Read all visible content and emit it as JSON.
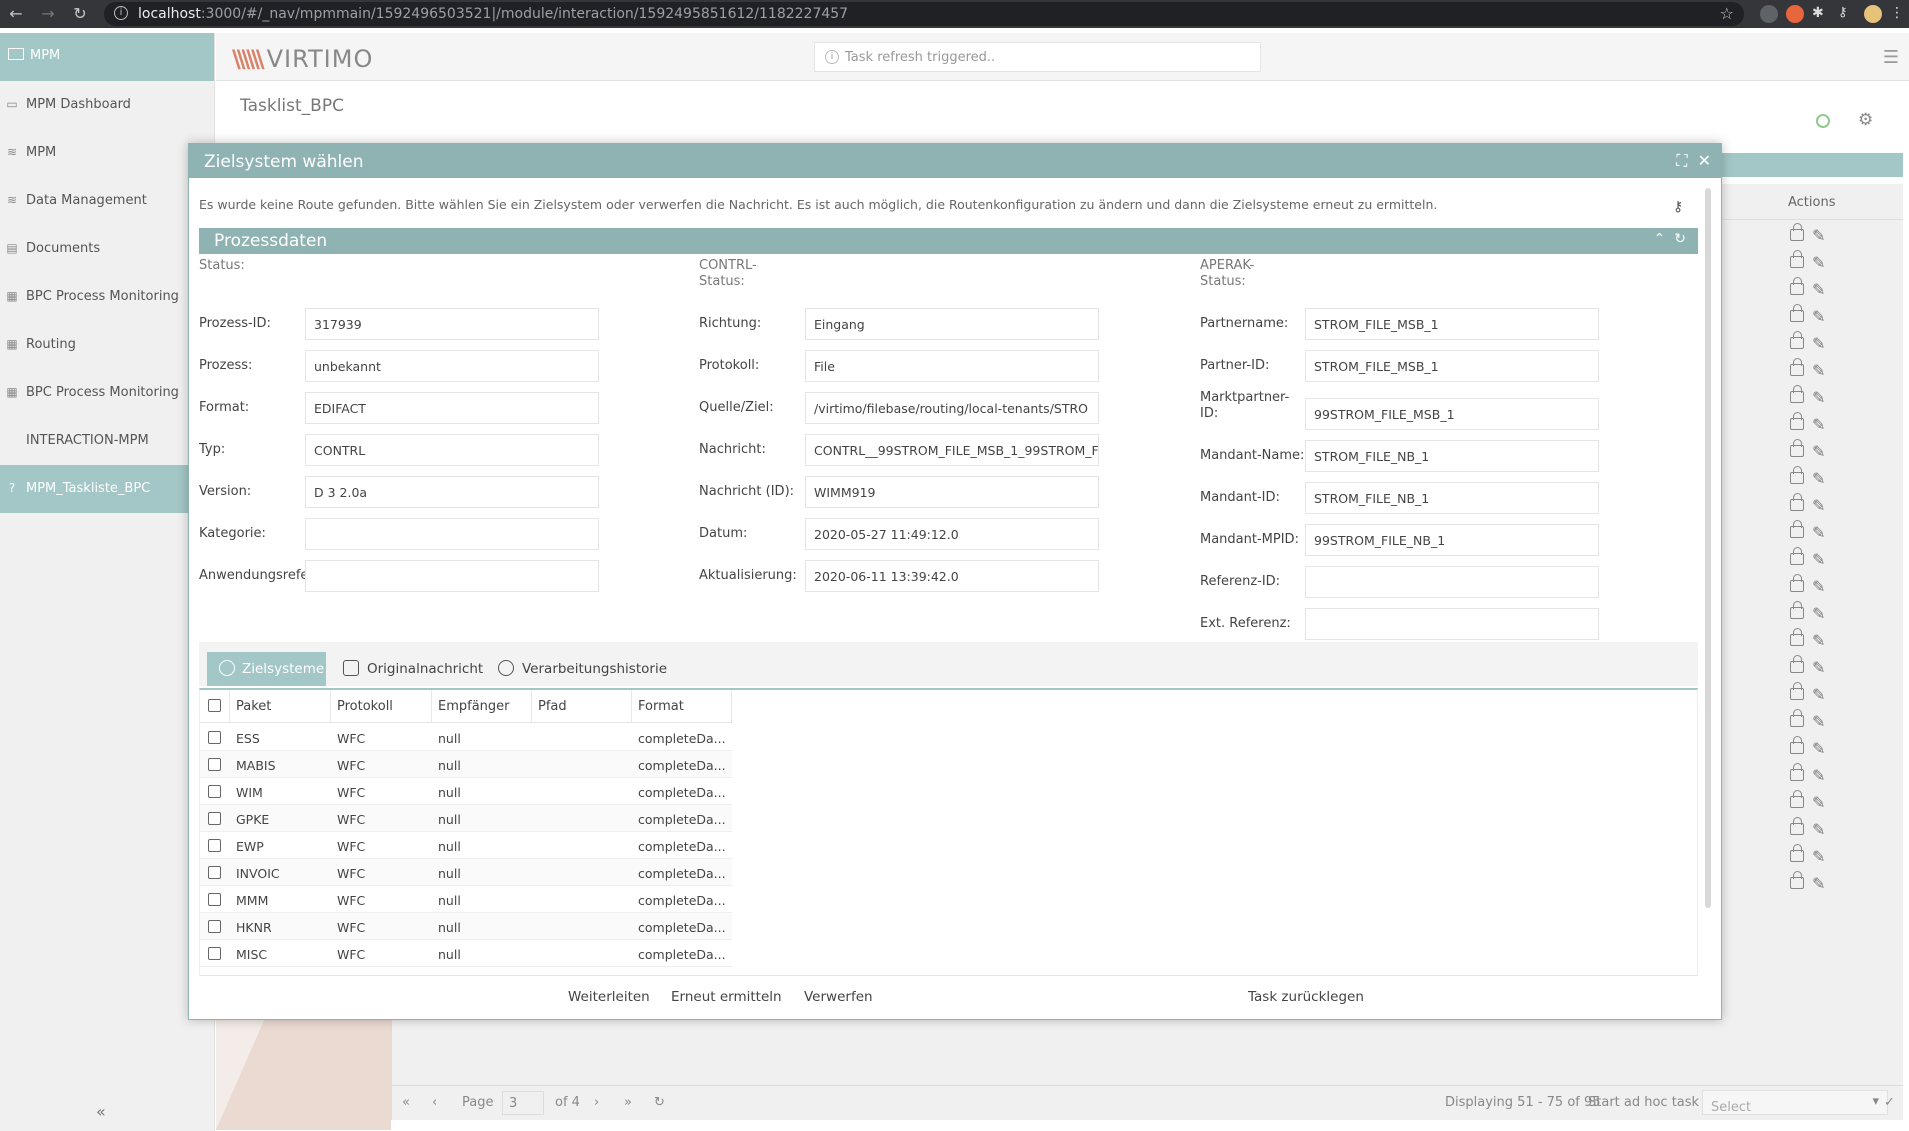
{
  "browser": {
    "url_host": "localhost",
    "url_rest": ":3000/#/_nav/mpmmain/1592496503521|/module/interaction/1592495851612/1182227457"
  },
  "sidebar": {
    "header": "MPM",
    "items": [
      {
        "label": "MPM Dashboard",
        "icon": "monitor-icon"
      },
      {
        "label": "MPM",
        "icon": "database-icon"
      },
      {
        "label": "Data Management",
        "icon": "database-icon"
      },
      {
        "label": "Documents",
        "icon": "document-icon"
      },
      {
        "label": "BPC Process Monitoring",
        "icon": "table-icon"
      },
      {
        "label": "Routing",
        "icon": "table-icon"
      },
      {
        "label": "BPC Process Monitoring",
        "icon": "table-icon"
      },
      {
        "label": "INTERACTION-MPM",
        "icon": ""
      },
      {
        "label": "MPM_Taskliste_BPC",
        "icon": "help-icon"
      }
    ],
    "collapse": "«"
  },
  "header": {
    "logo": "VIRTIMO",
    "notice": "Task refresh triggered.."
  },
  "page": {
    "title": "Tasklist_BPC",
    "actions_header": "Actions"
  },
  "pager": {
    "page_label": "Page",
    "page_value": "3",
    "of": "of 4",
    "displaying": "Displaying 51 - 75 of 95",
    "start_task": "Start ad hoc task",
    "select_placeholder": "Select"
  },
  "modal": {
    "title": "Zielsystem wählen",
    "message": "Es wurde keine Route gefunden. Bitte wählen Sie ein Zielsystem oder verwerfen die Nachricht. Es ist auch möglich, die Routenkonfiguration zu ändern und dann die Zielsysteme erneut zu ermitteln.",
    "section": "Prozessdaten",
    "col1": [
      {
        "label": "Status:",
        "value": null
      },
      {
        "label": "Prozess-ID:",
        "value": "317939"
      },
      {
        "label": "Prozess:",
        "value": "unbekannt"
      },
      {
        "label": "Format:",
        "value": "EDIFACT"
      },
      {
        "label": "Typ:",
        "value": "CONTRL"
      },
      {
        "label": "Version:",
        "value": "D 3 2.0a"
      },
      {
        "label": "Kategorie:",
        "value": ""
      },
      {
        "label": "Anwendungsrefer",
        "value": ""
      }
    ],
    "col2": [
      {
        "label": "CONTRL-",
        "label2": "Status:",
        "value": null
      },
      {
        "label": "Richtung:",
        "value": "Eingang"
      },
      {
        "label": "Protokoll:",
        "value": "File"
      },
      {
        "label": "Quelle/Ziel:",
        "value": "/virtimo/filebase/routing/local-tenants/STRO"
      },
      {
        "label": "Nachricht:",
        "value": "CONTRL__99STROM_FILE_MSB_1_99STROM_F"
      },
      {
        "label": "Nachricht (ID):",
        "value": "WIMM919"
      },
      {
        "label": "Datum:",
        "value": "2020-05-27 11:49:12.0"
      },
      {
        "label": "Aktualisierung:",
        "value": "2020-06-11 13:39:42.0"
      }
    ],
    "col3": [
      {
        "label": "APERAK-",
        "label2": "Status:",
        "value": null
      },
      {
        "label": "Partnername:",
        "value": "STROM_FILE_MSB_1"
      },
      {
        "label": "Partner-ID:",
        "value": "STROM_FILE_MSB_1"
      },
      {
        "label": "Marktpartner-",
        "label2": "ID:",
        "value": "99STROM_FILE_MSB_1"
      },
      {
        "label": "Mandant-Name:",
        "value": "STROM_FILE_NB_1"
      },
      {
        "label": "Mandant-ID:",
        "value": "STROM_FILE_NB_1"
      },
      {
        "label": "Mandant-MPID:",
        "value": "99STROM_FILE_NB_1"
      },
      {
        "label": "Referenz-ID:",
        "value": ""
      },
      {
        "label": "Ext. Referenz:",
        "value": ""
      }
    ],
    "tabs": [
      "Zielsysteme",
      "Originalnachricht",
      "Verarbeitungshistorie"
    ],
    "table": {
      "headers": [
        "Paket",
        "Protokoll",
        "Empfänger",
        "Pfad",
        "Format"
      ],
      "rows": [
        [
          "ESS",
          "WFC",
          "null",
          "",
          "completeDa..."
        ],
        [
          "MABIS",
          "WFC",
          "null",
          "",
          "completeDa..."
        ],
        [
          "WIM",
          "WFC",
          "null",
          "",
          "completeDa..."
        ],
        [
          "GPKE",
          "WFC",
          "null",
          "",
          "completeDa..."
        ],
        [
          "EWP",
          "WFC",
          "null",
          "",
          "completeDa..."
        ],
        [
          "INVOIC",
          "WFC",
          "null",
          "",
          "completeDa..."
        ],
        [
          "MMM",
          "WFC",
          "null",
          "",
          "completeDa..."
        ],
        [
          "HKNR",
          "WFC",
          "null",
          "",
          "completeDa..."
        ],
        [
          "MISC",
          "WFC",
          "null",
          "",
          "completeDa..."
        ]
      ]
    },
    "buttons": [
      "Weiterleiten",
      "Erneut ermitteln",
      "Verwerfen",
      "Task zurücklegen"
    ]
  }
}
